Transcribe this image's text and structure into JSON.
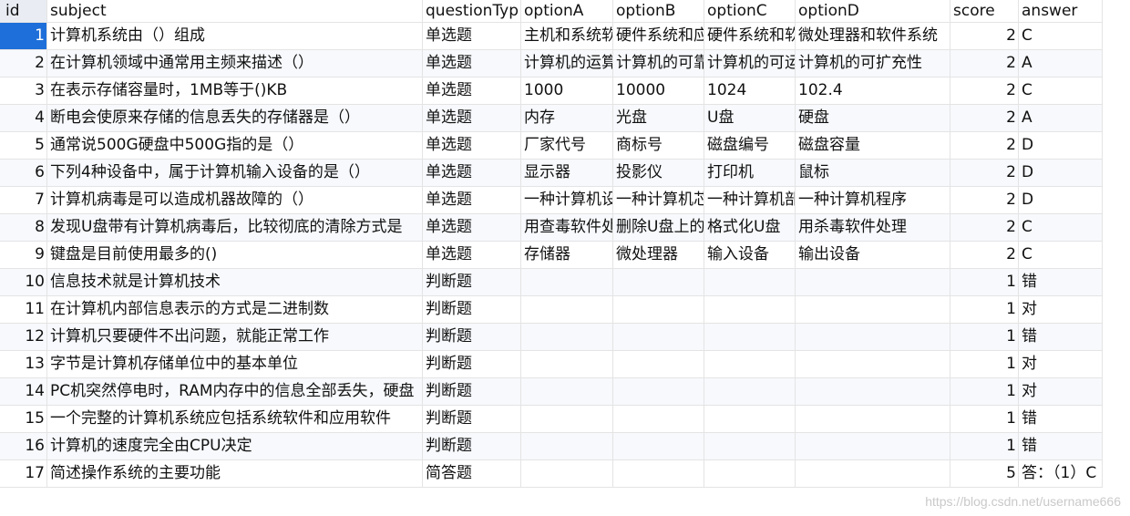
{
  "columns": {
    "id": "id",
    "subject": "subject",
    "questionType": "questionTyp",
    "optionA": "optionA",
    "optionB": "optionB",
    "optionC": "optionC",
    "optionD": "optionD",
    "score": "score",
    "answer": "answer"
  },
  "rows": [
    {
      "id": "1",
      "subject": "计算机系统由（）组成",
      "questionType": "单选题",
      "optionA": "主机和系统软件",
      "optionB": "硬件系统和应用软件",
      "optionC": "硬件系统和软件系统",
      "optionD": "微处理器和软件系统",
      "score": "2",
      "answer": "C"
    },
    {
      "id": "2",
      "subject": "在计算机领域中通常用主频来描述（）",
      "questionType": "单选题",
      "optionA": "计算机的运算速度",
      "optionB": "计算机的可靠性",
      "optionC": "计算机的可运行性",
      "optionD": "计算机的可扩充性",
      "score": "2",
      "answer": "A"
    },
    {
      "id": "3",
      "subject": "在表示存储容量时，1MB等于()KB",
      "questionType": "单选题",
      "optionA": "1000",
      "optionB": "10000",
      "optionC": "1024",
      "optionD": "102.4",
      "score": "2",
      "answer": "C"
    },
    {
      "id": "4",
      "subject": "断电会使原来存储的信息丢失的存储器是（）",
      "questionType": "单选题",
      "optionA": "内存",
      "optionB": "光盘",
      "optionC": "U盘",
      "optionD": "硬盘",
      "score": "2",
      "answer": "A"
    },
    {
      "id": "5",
      "subject": "通常说500G硬盘中500G指的是（）",
      "questionType": "单选题",
      "optionA": "厂家代号",
      "optionB": "商标号",
      "optionC": "磁盘编号",
      "optionD": "磁盘容量",
      "score": "2",
      "answer": "D"
    },
    {
      "id": "6",
      "subject": "下列4种设备中，属于计算机输入设备的是（）",
      "questionType": "单选题",
      "optionA": "显示器",
      "optionB": "投影仪",
      "optionC": "打印机",
      "optionD": "鼠标",
      "score": "2",
      "answer": "D"
    },
    {
      "id": "7",
      "subject": "计算机病毒是可以造成机器故障的（）",
      "questionType": "单选题",
      "optionA": "一种计算机设备",
      "optionB": "一种计算机芯片",
      "optionC": "一种计算机部件",
      "optionD": "一种计算机程序",
      "score": "2",
      "answer": "D"
    },
    {
      "id": "8",
      "subject": "发现U盘带有计算机病毒后，比较彻底的清除方式是",
      "questionType": "单选题",
      "optionA": "用查毒软件处理",
      "optionB": "删除U盘上的所有",
      "optionC": "格式化U盘",
      "optionD": "用杀毒软件处理",
      "score": "2",
      "answer": "C"
    },
    {
      "id": "9",
      "subject": "键盘是目前使用最多的()",
      "questionType": "单选题",
      "optionA": "存储器",
      "optionB": "微处理器",
      "optionC": "输入设备",
      "optionD": "输出设备",
      "score": "2",
      "answer": "C"
    },
    {
      "id": "10",
      "subject": "信息技术就是计算机技术",
      "questionType": "判断题",
      "optionA": "",
      "optionB": "",
      "optionC": "",
      "optionD": "",
      "score": "1",
      "answer": "错"
    },
    {
      "id": "11",
      "subject": "在计算机内部信息表示的方式是二进制数",
      "questionType": "判断题",
      "optionA": "",
      "optionB": "",
      "optionC": "",
      "optionD": "",
      "score": "1",
      "answer": "对"
    },
    {
      "id": "12",
      "subject": "计算机只要硬件不出问题，就能正常工作",
      "questionType": "判断题",
      "optionA": "",
      "optionB": "",
      "optionC": "",
      "optionD": "",
      "score": "1",
      "answer": "错"
    },
    {
      "id": "13",
      "subject": "字节是计算机存储单位中的基本单位",
      "questionType": "判断题",
      "optionA": "",
      "optionB": "",
      "optionC": "",
      "optionD": "",
      "score": "1",
      "answer": "对"
    },
    {
      "id": "14",
      "subject": "PC机突然停电时，RAM内存中的信息全部丢失，硬盘",
      "questionType": "判断题",
      "optionA": "",
      "optionB": "",
      "optionC": "",
      "optionD": "",
      "score": "1",
      "answer": "对"
    },
    {
      "id": "15",
      "subject": "一个完整的计算机系统应包括系统软件和应用软件",
      "questionType": "判断题",
      "optionA": "",
      "optionB": "",
      "optionC": "",
      "optionD": "",
      "score": "1",
      "answer": "错"
    },
    {
      "id": "16",
      "subject": "计算机的速度完全由CPU决定",
      "questionType": "判断题",
      "optionA": "",
      "optionB": "",
      "optionC": "",
      "optionD": "",
      "score": "1",
      "answer": "错"
    },
    {
      "id": "17",
      "subject": "简述操作系统的主要功能",
      "questionType": "简答题",
      "optionA": "",
      "optionB": "",
      "optionC": "",
      "optionD": "",
      "score": "5",
      "answer": "答：（1）C"
    }
  ],
  "watermark": "https://blog.csdn.net/username666",
  "colors": {
    "selection": "#1e6fd9",
    "grid_line": "#e4e4e4",
    "alt_row": "#f7f9fc"
  }
}
